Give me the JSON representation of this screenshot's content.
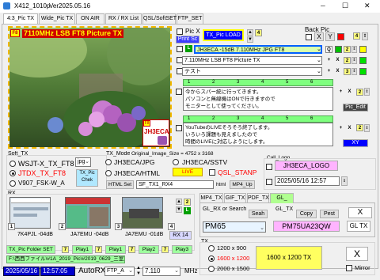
{
  "window": {
    "title": "X412_1010p",
    "version": "Ver2025.05.16"
  },
  "titlebar": {
    "minimize": "─",
    "maximize": "☐",
    "close": "✕"
  },
  "tabs": [
    "4:3_Pic TX",
    "Wide_Pic TX",
    "ON AIR",
    "RX / RX List",
    "QSL/SoftSET",
    "FTP_SET"
  ],
  "pic_x": {
    "label": "Pic X",
    "print_sc": "Print Sc",
    "load": "TX_Pic LOAD",
    "num": "4",
    "back_pic": "Back Pic",
    "x": "X",
    "y": "Y",
    "num2": "4"
  },
  "image_overlay": {
    "top": "7110MHz LSB FT8 Picture TX",
    "corner": "F8",
    "call": "JH3ECA",
    "mini": "F8"
  },
  "text_rows": [
    {
      "value": "JH3ECA -15dB 7.110MHz JPG FT8",
      "tag": "L",
      "q": "Q",
      "num": "2"
    },
    {
      "value": "7.110MHz LSB FT8 Picture TX",
      "tag": "+",
      "q": "X",
      "num": "2"
    },
    {
      "value": "テスト",
      "tag": "+",
      "q": "X",
      "num": "3"
    }
  ],
  "msg_tabs": [
    "1",
    "2",
    "3",
    "4",
    "5",
    "6"
  ],
  "msg1": "今からスパー統に行ってきます。\nパソコンと無線機はONで行きますので\nモニターとして使ってください。",
  "msg1_btns": {
    "plus": "+",
    "x": "X",
    "num": "2",
    "pic_edit": "Pic_Edit"
  },
  "msg2_tabs": [
    "1",
    "2",
    "3",
    "4",
    "5",
    "6"
  ],
  "msg2": "YouTubeのLIVEそろそろ終了します。\nいろいろ課題も見えましたので\n時間のLIVEに対応しようにします。",
  "msg2_btns": {
    "plus": "+",
    "x": "X",
    "num": "2",
    "xy": "XY"
  },
  "soft_tx": {
    "label": "Soft_TX",
    "items": [
      "WSJT-X_TX_FT8",
      "JTDX_TX_FT8",
      "V907_FSK-W_A"
    ],
    "jpg": "jpg",
    "tx_pic_chek": "TX_Pic\nChek"
  },
  "tx_mode": {
    "label": "TX_Mode",
    "orig_size": "Original_Image_Size = 4752 x 3168",
    "items": [
      "JH3ECA/JPG",
      "JH3ECA/SSTV",
      "JH3ECA/HTML",
      "QSL_STANP"
    ],
    "live": "LIVE",
    "html_set": "HTML Set",
    "file": "SF_TX1_RX4",
    "html": "html",
    "mp4_up": "MP4_Up"
  },
  "call_logo": {
    "label": "Call_Logo",
    "logo": "JH3ECA_LOGO",
    "date": "2025/05/16  12:57"
  },
  "rx": {
    "label": "RX",
    "captions": [
      "7K4PJL -04dB",
      "JA7EMU -04dB",
      "JA7EMU -01dB"
    ],
    "nums": [
      "1",
      "2",
      "3",
      "4"
    ],
    "rx14": "RX 14",
    "folder_set": "TX_Pic  Folder SET",
    "file_path": "F:\\西西ファイル\\#1A_2019_Pic\\#2019_0629_三室戸寺",
    "plays": [
      "Play1",
      "Play1",
      "Play2",
      "Play3"
    ],
    "pnums": [
      "7",
      "7",
      "7",
      "7"
    ],
    "p2": "2"
  },
  "bottom": {
    "date": "2025/05/16",
    "time": "12:57:05",
    "autorx": "AutoRX",
    "ftp": "FTP_A",
    "freq": "7.110",
    "mhz": "MHz"
  },
  "gl_tabs": [
    "MP4_TX",
    "GIF_TX",
    "PDF_TX",
    "GL_"
  ],
  "gl": {
    "rx_label": "GL_RX or Search",
    "search": "Seah",
    "tx_label": "GL_TX",
    "copy": "Copy",
    "pest": "Pest",
    "x": "X",
    "rx_val": "PM65",
    "tx_val": "PM75UA23QW",
    "gltx": "GL TX"
  },
  "tx": {
    "label": "TX",
    "sizes": [
      "1200 x 900",
      "1600 x 1200",
      "2000 x 1500"
    ],
    "selected": 1,
    "big": "1600 x 1200   TX",
    "x": "X",
    "mirror": "Mirror"
  }
}
